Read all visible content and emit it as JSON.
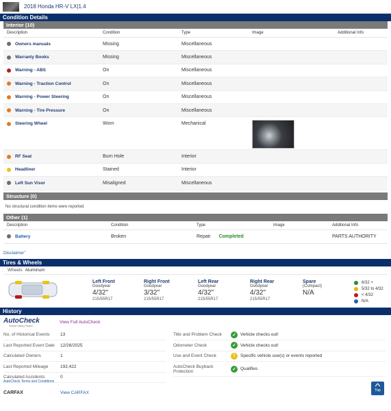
{
  "vehicle": {
    "title": "2018 Honda HR-V LX",
    "engine": "1.4"
  },
  "condition": {
    "section_title": "Condition Details",
    "interior": {
      "title": "Interior (10)",
      "columns": [
        "Description",
        "Condition",
        "Type",
        "Image",
        "Additional Info"
      ],
      "items": [
        {
          "name": "Owners manuals",
          "condition": "Missing",
          "type": "Miscellaneous",
          "color": "#6d6d6d"
        },
        {
          "name": "Warranty Books",
          "condition": "Missing",
          "type": "Miscellaneous",
          "color": "#6d6d6d"
        },
        {
          "name": "Warning - ABS",
          "condition": "On",
          "type": "Miscellaneous",
          "color": "#b31d1d"
        },
        {
          "name": "Warning - Traction Control",
          "condition": "On",
          "type": "Miscellaneous",
          "color": "#e07b26"
        },
        {
          "name": "Warning - Power Steering",
          "condition": "On",
          "type": "Miscellaneous",
          "color": "#e07b26"
        },
        {
          "name": "Warning - Tire Pressure",
          "condition": "On",
          "type": "Miscellaneous",
          "color": "#e07b26"
        },
        {
          "name": "Steering Wheel",
          "condition": "Worn",
          "type": "Mechanical",
          "color": "#e07b26",
          "has_image": true
        },
        {
          "name": "RF Seat",
          "condition": "Burn Hole",
          "type": "Interior",
          "color": "#e07b26"
        },
        {
          "name": "Headliner",
          "condition": "Stained",
          "type": "Interior",
          "color": "#e8c21c"
        },
        {
          "name": "Left Sun Visor",
          "condition": "Misaligned",
          "type": "Miscellaneous",
          "color": "#6d6d6d"
        }
      ]
    },
    "structure": {
      "title": "Structure (0)",
      "note": "No structural condition items were reported"
    },
    "other": {
      "title": "Other (1)",
      "columns": [
        "Description",
        "Condition",
        "Type",
        "Image",
        "Additional Info"
      ],
      "items": [
        {
          "name": "Battery",
          "condition": "Broken",
          "type": "Repair",
          "status": "Completed",
          "additional": "PARTS AUTHORITY",
          "color": "#6d6d6d"
        }
      ]
    },
    "disclaimer": "Disclaimer"
  },
  "tires": {
    "title": "Tires & Wheels",
    "wheels_label": "Wheels",
    "wheels_value": "Aluminum",
    "positions": [
      {
        "pos": "Left Front",
        "brand": "Goodyear",
        "depth": "4/32\"",
        "size": "215/55R17"
      },
      {
        "pos": "Right Front",
        "brand": "Goodyear",
        "depth": "3/32\"",
        "size": "215/55R17"
      },
      {
        "pos": "Left Rear",
        "brand": "Goodyear",
        "depth": "4/32\"",
        "size": "215/55R17"
      },
      {
        "pos": "Right Rear",
        "brand": "Goodyear",
        "depth": "4/32\"",
        "size": "215/55R17"
      },
      {
        "pos": "Spare",
        "brand": "(Compact)",
        "depth": "N/A",
        "size": ""
      }
    ],
    "legend": [
      {
        "label": "6/32 +",
        "color": "#2e8b2e"
      },
      {
        "label": "5/32 to 4/32",
        "color": "#e8b21c"
      },
      {
        "label": "< 4/32",
        "color": "#b31d1d"
      },
      {
        "label": "N/A",
        "color": "#2b5ea7"
      }
    ]
  },
  "history": {
    "title": "History",
    "autocheck_logo": "AutoCheck",
    "autocheck_tagline": "Vehicle History Report",
    "view_autocheck": "View Full AutoCheck",
    "rows": [
      {
        "k": "No. of Historical Events",
        "v": "13"
      },
      {
        "k": "Last Reported Event Date",
        "v": "12/26/2025"
      },
      {
        "k": "Calculated Owners",
        "v": "1"
      },
      {
        "k": "Last Reported Mileage",
        "v": "192,422"
      },
      {
        "k": "Calculated Accidents",
        "v": "0"
      }
    ],
    "terms": "AutoCheck Terms and Conditions",
    "checks": [
      {
        "k": "Title and Problem Check",
        "v": "Vehicle checks out!",
        "status": "ok"
      },
      {
        "k": "Odometer Check",
        "v": "Vehicle checks out!",
        "status": "ok"
      },
      {
        "k": "Use and Event Check",
        "v": "Specific vehicle use(s) or events reported",
        "status": "warn"
      },
      {
        "k": "AutoCheck Buyback Protection",
        "v": "Qualifies",
        "status": "ok"
      }
    ],
    "carfax_label": "CARFAX",
    "view_carfax": "View CARFAX"
  },
  "top_button": "Top"
}
